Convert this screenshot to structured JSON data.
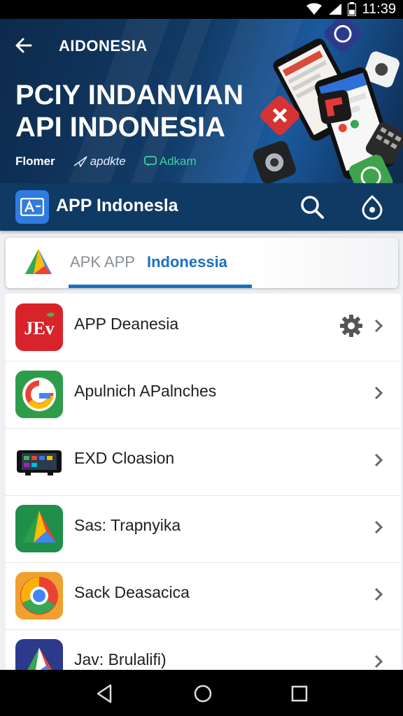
{
  "status_bar": {
    "time": "11:39",
    "icons": [
      "wifi-icon",
      "signal-icon",
      "battery-icon"
    ]
  },
  "hero": {
    "brand": "AIDONESIA",
    "title_line1": "PCIY INDANVIAN",
    "title_line2": "API INDONESIA",
    "links": [
      "Flomer",
      "apdkte",
      "Adkam"
    ]
  },
  "app_bar": {
    "title": "APP Indonesla",
    "logo_text": "A"
  },
  "tabs": {
    "inactive": "APK APP",
    "active": "Indonessia"
  },
  "list": {
    "items": [
      {
        "label": "APP Deanesia",
        "icon": "jev-app-icon",
        "logo_text": "JEv"
      },
      {
        "label": "Apulnich APalnches",
        "icon": "google-g-icon"
      },
      {
        "label": "EXD Cloasion",
        "icon": "tablet-device-icon"
      },
      {
        "label": "Sas: Trapnyika",
        "icon": "drive-triangle-icon"
      },
      {
        "label": "Sack Deasacica",
        "icon": "chrome-icon"
      },
      {
        "label": "Jav: Brulalifi)",
        "icon": "drive-dark-icon"
      }
    ]
  },
  "colors": {
    "accent": "#1c6fc0",
    "app_bar": "#0f3a64",
    "hero": "#123a66"
  }
}
